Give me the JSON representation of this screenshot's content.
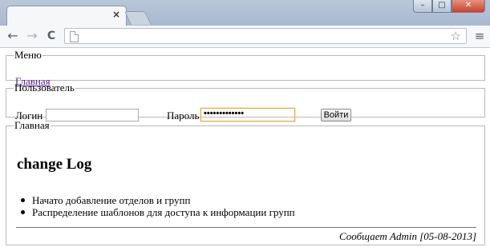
{
  "browser": {
    "tab_close_glyph": "×",
    "back_glyph": "←",
    "forward_glyph": "→",
    "reload_glyph": "C",
    "star_glyph": "☆",
    "menu_glyph": "≡",
    "minimize_glyph": "–",
    "maximize_glyph": "□",
    "close_glyph": "✕",
    "icons": [
      "back-icon",
      "forward-icon",
      "reload-icon",
      "page-icon",
      "bookmark-star-icon",
      "chrome-menu-icon"
    ]
  },
  "menu": {
    "legend": "Меню",
    "home_link": "Главная"
  },
  "user": {
    "legend": "Пользователь",
    "login_label": "Логин",
    "login_value": "",
    "password_label": "Пароль",
    "password_value": "•••••••••••••",
    "submit_label": "Войти"
  },
  "main": {
    "legend": "Главная",
    "heading": "change Log",
    "changes": [
      "Начато добавление отделов и групп",
      "Распределение шаблонов для доступа к информации групп"
    ],
    "posted_by": "Сообщает Admin [05-08-2013]"
  },
  "colors": {
    "link": "#551a8b",
    "focus_border": "#e0a94a"
  }
}
